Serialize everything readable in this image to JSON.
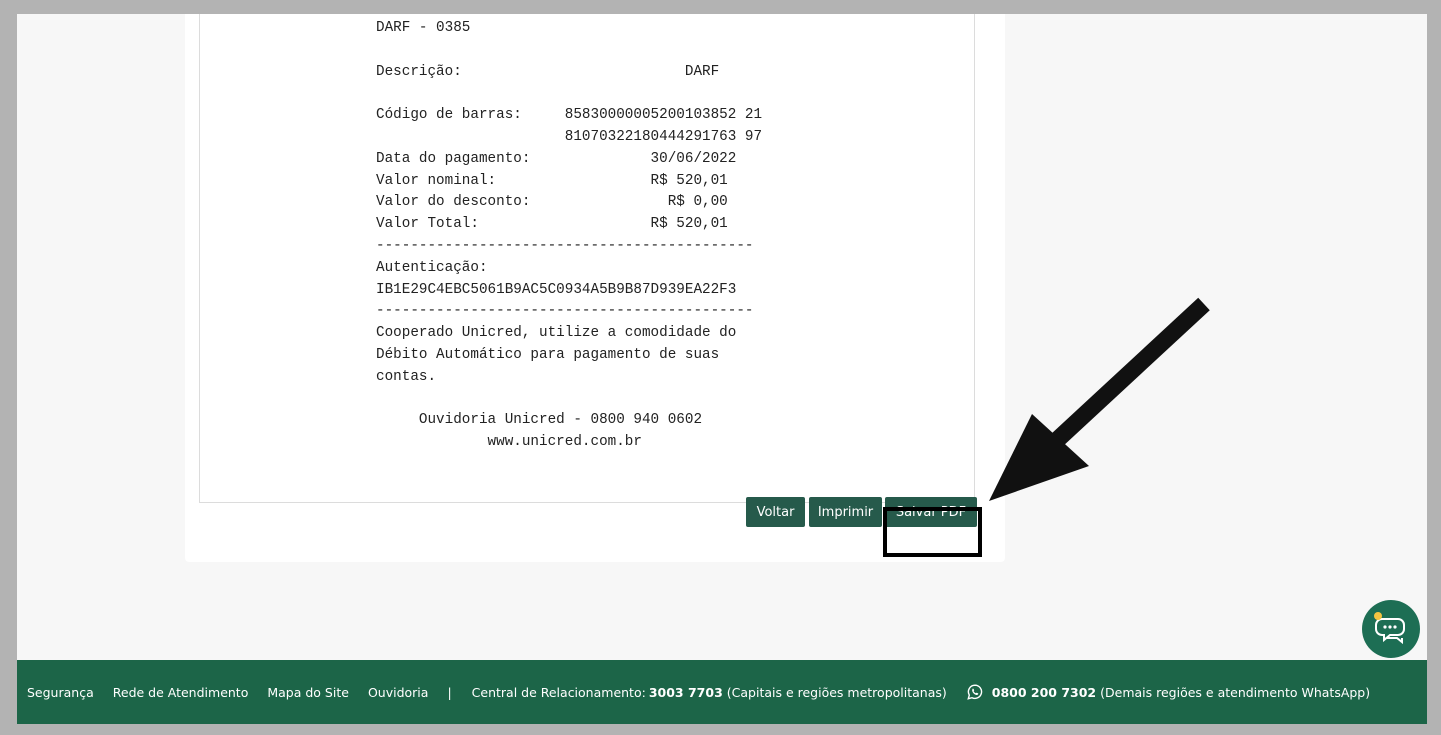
{
  "receipt": {
    "lines": [
      "DARF - 0385",
      "",
      "Descrição:                          DARF",
      "",
      "Código de barras:     85830000005200103852 21",
      "                      81070322180444291763 97",
      "Data do pagamento:              30/06/2022",
      "Valor nominal:                  R$ 520,01",
      "Valor do desconto:                R$ 0,00",
      "Valor Total:                    R$ 520,01",
      "--------------------------------------------",
      "Autenticação:",
      "IB1E29C4EBC5061B9AC5C0934A5B9B87D939EA22F3",
      "--------------------------------------------",
      "Cooperado Unicred, utilize a comodidade do",
      "Débito Automático para pagamento de suas",
      "contas.",
      "",
      "     Ouvidoria Unicred - 0800 940 0602",
      "             www.unicred.com.br"
    ]
  },
  "actions": {
    "voltar": "Voltar",
    "imprimir": "Imprimir",
    "salvar_pdf": "Salvar PDF"
  },
  "footer": {
    "links": [
      "Segurança",
      "Rede de Atendimento",
      "Mapa do Site",
      "Ouvidoria"
    ],
    "separator": "|",
    "central_label": "Central de Relacionamento:",
    "central_phone": "3003 7703",
    "central_note": "(Capitais e regiões metropolitanas)",
    "whatsapp_phone": "0800 200 7302",
    "whatsapp_note": "(Demais regiões e atendimento WhatsApp)"
  },
  "colors": {
    "button_bg": "#265a4b",
    "footer_bg": "#1c6548",
    "chat_bg": "#1d6e54",
    "chat_dot": "#f5c542"
  },
  "icons": {
    "chat": "chat-bubbles-icon",
    "whatsapp": "whatsapp-icon",
    "annotation": "arrow-pointer-icon"
  }
}
